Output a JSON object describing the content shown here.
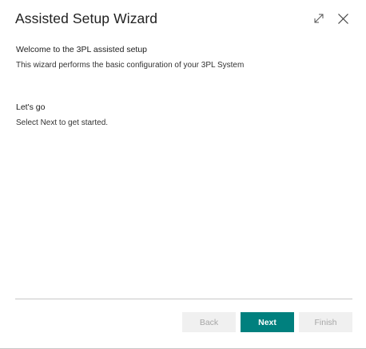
{
  "dialog": {
    "title": "Assisted Setup Wizard",
    "expand_icon": "expand-icon",
    "close_icon": "close-icon"
  },
  "welcome": {
    "heading": "Welcome to the 3PL assisted setup",
    "text": "This wizard performs the basic configuration of your 3PL System"
  },
  "letsgo": {
    "heading": "Let's go",
    "text": "Select Next to get started."
  },
  "footer": {
    "back_label": "Back",
    "next_label": "Next",
    "finish_label": "Finish"
  },
  "colors": {
    "primary": "#00807e",
    "disabled_bg": "#f0f0f0",
    "disabled_text": "#a6a6a6"
  }
}
